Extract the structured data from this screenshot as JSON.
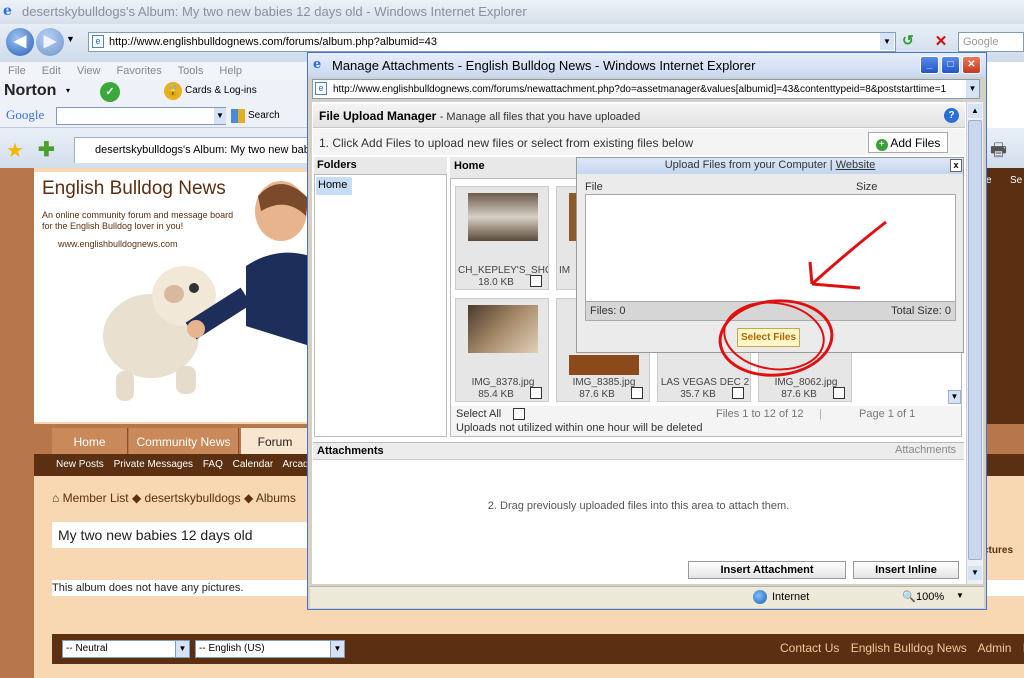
{
  "outer_window": {
    "title": "desertskybulldogs's Album: My two new babies 12 days old - Windows Internet Explorer",
    "address": "http://www.englishbulldognews.com/forums/album.php?albumid=43",
    "search_placeholder": "Google",
    "menu": [
      "File",
      "Edit",
      "View",
      "Favorites",
      "Tools",
      "Help"
    ],
    "norton_label": "Norton",
    "cards_label": "Cards & Log-ins",
    "google_label": "Google",
    "search_label": "Search",
    "tab_label": "desertskybulldogs's Album: My two new babies 1",
    "right_partial": [
      "e",
      "Se"
    ]
  },
  "site": {
    "title": "English Bulldog News",
    "tagline": "An online community forum and message board for the English Bulldog lover in you!",
    "url": "www.englishbulldognews.com",
    "nav_tabs": [
      "Home",
      "Community News",
      "Forum"
    ],
    "subnav": [
      "New Posts",
      "Private Messages",
      "FAQ",
      "Calendar",
      "Arcad"
    ],
    "breadcrumb": [
      "Member List",
      "desertskybulldogs",
      "Albums"
    ],
    "album_title": "My two new babies 12 days old",
    "no_pictures": "This album does not have any pictures.",
    "right_partial_label": "ctures",
    "select_neutral": "-- Neutral",
    "select_language": "-- English (US)",
    "footer_links": [
      "Contact Us",
      "English Bulldog News",
      "Admin",
      "Mo"
    ]
  },
  "popup": {
    "title": "Manage Attachments - English Bulldog News - Windows Internet Explorer",
    "address": "http://www.englishbulldognews.com/forums/newattachment.php?do=assetmanager&values[albumid]=43&contenttypeid=8&poststarttime=1",
    "manager_title": "File Upload Manager",
    "manager_desc": "- Manage all files that you have uploaded",
    "step1": "1. Click Add Files to upload new files or select from existing files below",
    "add_files": "Add Files",
    "folders_header": "Folders",
    "folder_home": "Home",
    "files_header": "Home",
    "thumbs": [
      {
        "name": "CH_KEPLEY'S_SHO",
        "size": "18.0 KB"
      },
      {
        "name": "IM",
        "size": ""
      },
      {
        "name": "IMG_8378.jpg",
        "size": "85.4 KB"
      },
      {
        "name": "IMG_8385.jpg",
        "size": "87.6 KB"
      },
      {
        "name": "LAS VEGAS DEC 2",
        "size": "35.7 KB"
      },
      {
        "name": "IMG_8062.jpg",
        "size": "87.6 KB"
      }
    ],
    "select_all": "Select All",
    "files_count": "Files 1 to 12 of 12",
    "page_info": "Page 1 of 1",
    "uploads_note": "Uploads not utilized within one hour will be deleted",
    "attachments_header": "Attachments",
    "attachments_right": "Attachments",
    "drag_text": "2. Drag previously uploaded files into this area to attach them.",
    "insert_attachment": "Insert Attachment",
    "insert_inline": "Insert Inline",
    "status_zone": "Internet",
    "zoom": "100%"
  },
  "upload_dialog": {
    "title": "Upload Files from your Computer",
    "separator": "|",
    "website_link": "Website",
    "col_file": "File",
    "col_size": "Size",
    "files_count": "Files: 0",
    "total_size": "Total Size: 0",
    "select_files": "Select Files"
  },
  "colors": {
    "site_brown": "#5a2f12",
    "site_tan": "#f8d7b3",
    "annotation_red": "#e01010"
  }
}
